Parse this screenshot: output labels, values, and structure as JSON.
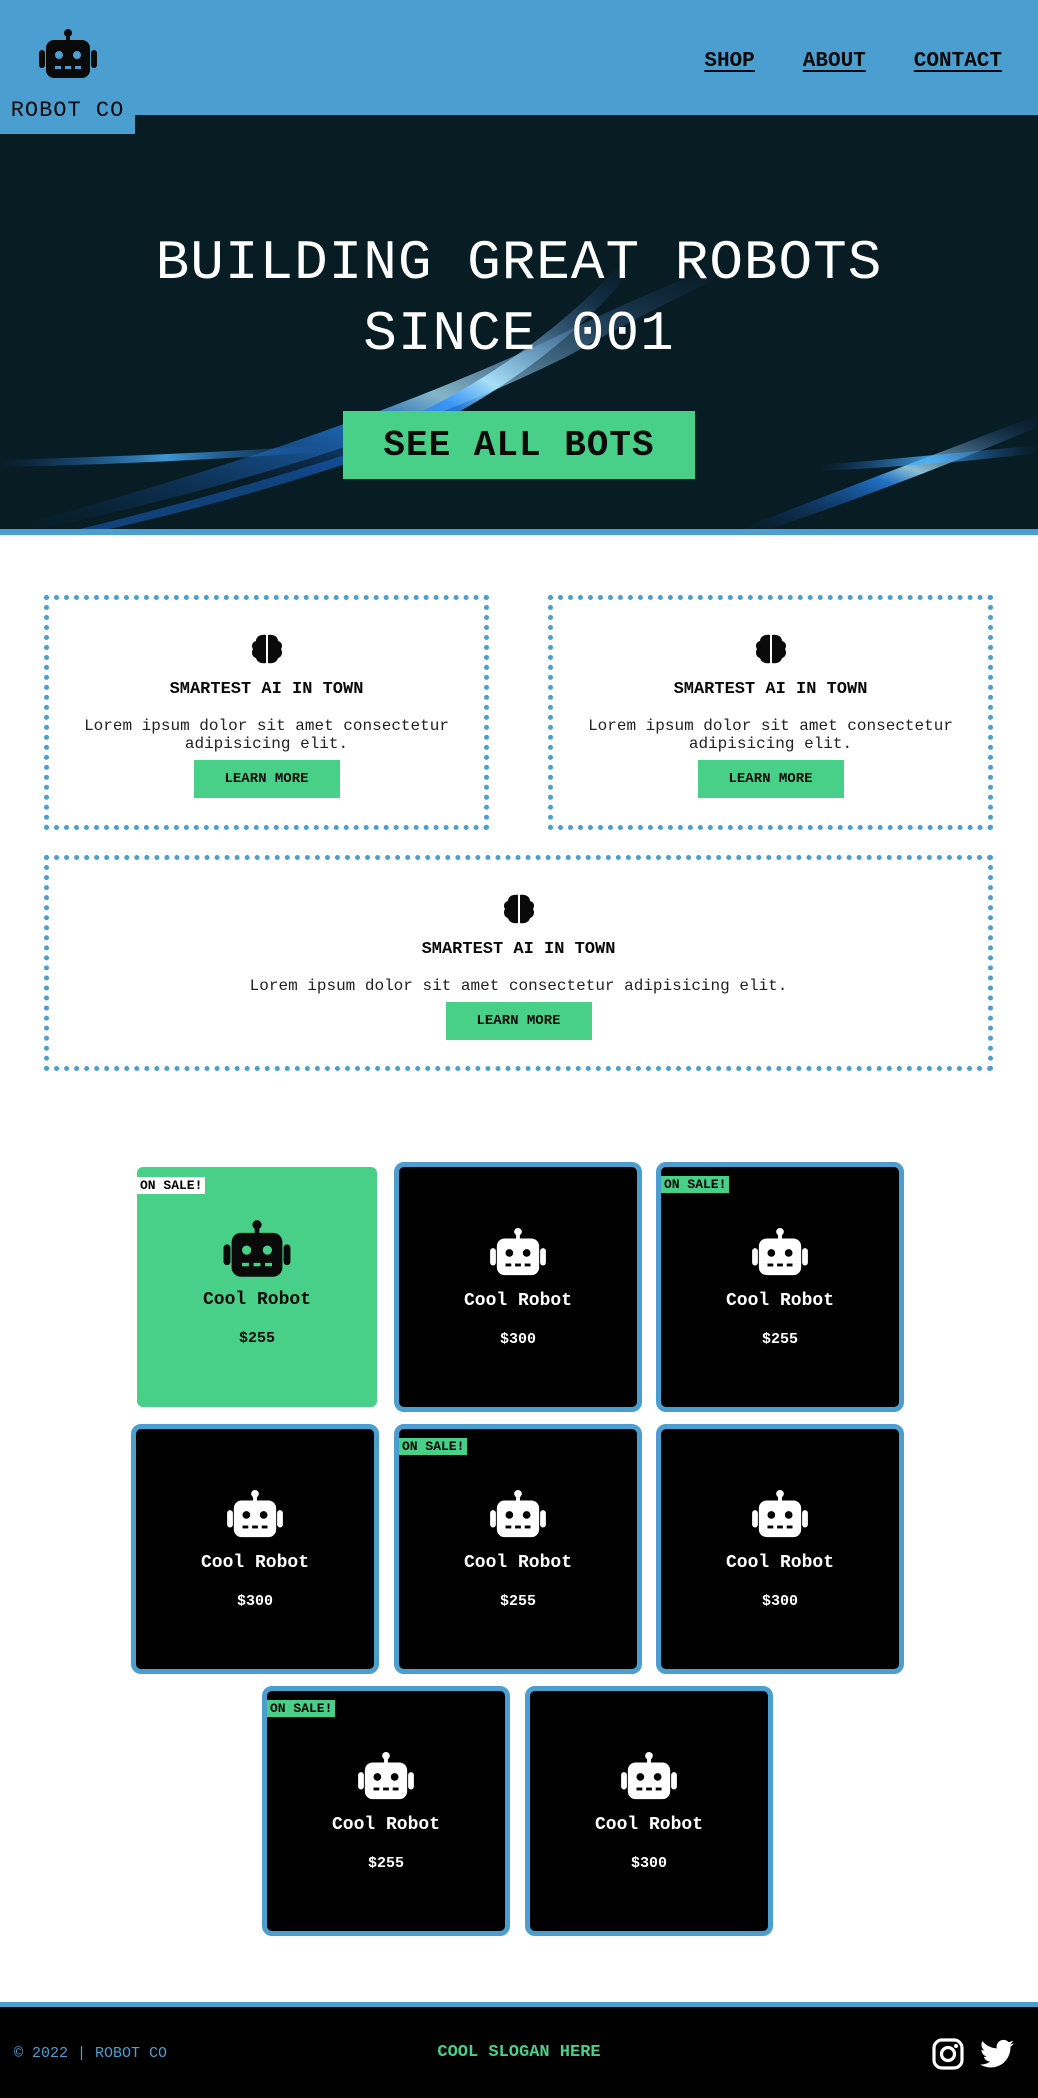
{
  "header": {
    "logo_text": "ROBOT CO",
    "nav": [
      "SHOP",
      "ABOUT",
      "CONTACT"
    ]
  },
  "hero": {
    "title_line1": "BUILDING GREAT ROBOTS",
    "title_line2": "SINCE 001",
    "button": "SEE ALL BOTS"
  },
  "features": [
    {
      "title": "SMARTEST AI IN TOWN",
      "text": "Lorem ipsum dolor sit amet consectetur adipisicing elit.",
      "button": "LEARN MORE",
      "icon": "brain-icon"
    },
    {
      "title": "SMARTEST AI IN TOWN",
      "text": "Lorem ipsum dolor sit amet consectetur adipisicing elit.",
      "button": "LEARN MORE",
      "icon": "brain-icon"
    },
    {
      "title": "SMARTEST AI IN TOWN",
      "text": "Lorem ipsum dolor sit amet consectetur adipisicing elit.",
      "button": "LEARN MORE",
      "icon": "brain-icon"
    }
  ],
  "products": [
    {
      "name": "Cool Robot",
      "price": "$255",
      "badge": "ON SALE!",
      "featured": true
    },
    {
      "name": "Cool Robot",
      "price": "$300",
      "badge": ""
    },
    {
      "name": "Cool Robot",
      "price": "$255",
      "badge": "ON SALE!"
    },
    {
      "name": "Cool Robot",
      "price": "$300",
      "badge": ""
    },
    {
      "name": "Cool Robot",
      "price": "$255",
      "badge": "ON SALE!"
    },
    {
      "name": "Cool Robot",
      "price": "$300",
      "badge": ""
    },
    {
      "name": "Cool Robot",
      "price": "$255",
      "badge": "ON SALE!"
    },
    {
      "name": "Cool Robot",
      "price": "$300",
      "badge": ""
    }
  ],
  "footer": {
    "copyright": "© 2022 | ROBOT CO",
    "slogan": "COOL SLOGAN HERE",
    "social_icons": [
      "instagram-icon",
      "twitter-icon"
    ]
  },
  "colors": {
    "blue": "#4a9fd0",
    "green": "#49d088",
    "dark": "#081c24",
    "black": "#000000"
  }
}
